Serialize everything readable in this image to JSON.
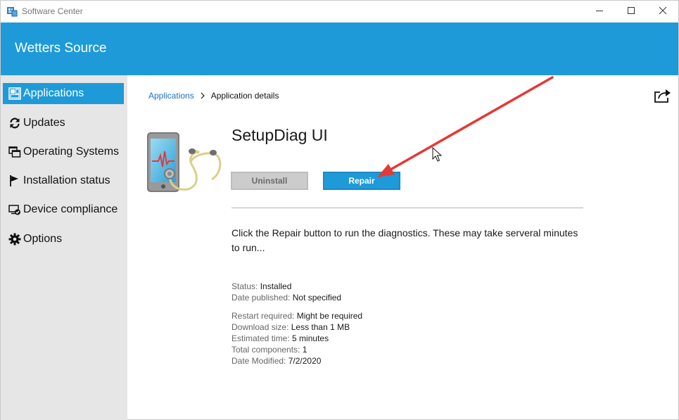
{
  "window": {
    "title": "Software Center",
    "icon": "software-center-icon",
    "controls": [
      "minimize-icon",
      "maximize-icon",
      "close-icon"
    ]
  },
  "header": {
    "title": "Wetters Source",
    "color": "#1e9ad9"
  },
  "sidebar": {
    "items": [
      {
        "label": "Applications",
        "icon": "applications-grid-icon",
        "active": true
      },
      {
        "label": "Updates",
        "icon": "refresh-icon",
        "active": false
      },
      {
        "label": "Operating Systems",
        "icon": "windows-stack-icon",
        "active": false
      },
      {
        "label": "Installation status",
        "icon": "flag-icon",
        "active": false
      },
      {
        "label": "Device compliance",
        "icon": "device-check-icon",
        "active": false
      },
      {
        "label": "Options",
        "icon": "gear-icon",
        "active": false
      }
    ]
  },
  "breadcrumb": {
    "link": "Applications",
    "current": "Application details"
  },
  "app": {
    "title": "SetupDiag UI",
    "image_icon": "phone-stethoscope-icon",
    "uninstall_label": "Uninstall",
    "repair_label": "Repair",
    "description": "Click the Repair button to run the diagnostics.  These may take serveral minutes to run...",
    "details_group1": [
      {
        "label": "Status:",
        "value": "Installed"
      },
      {
        "label": "Date published:",
        "value": "Not specified"
      }
    ],
    "details_group2": [
      {
        "label": "Restart required:",
        "value": "Might be required"
      },
      {
        "label": "Download size:",
        "value": "Less than 1 MB"
      },
      {
        "label": "Estimated time:",
        "value": "5 minutes"
      },
      {
        "label": "Total components:",
        "value": "1"
      },
      {
        "label": "Date Modified:",
        "value": "7/2/2020"
      }
    ]
  },
  "annotation": {
    "arrow_color": "#e53935",
    "cursor_icon": "mouse-pointer-icon"
  }
}
